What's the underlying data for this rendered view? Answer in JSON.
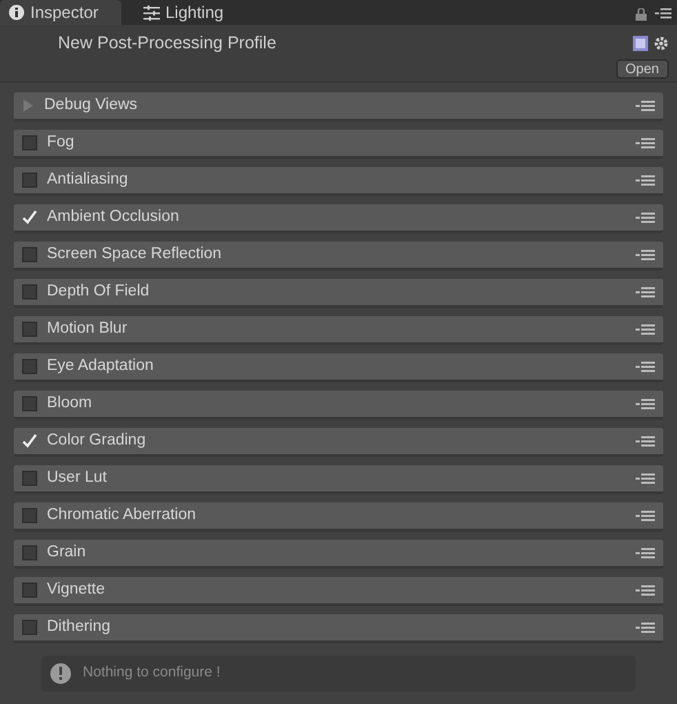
{
  "tabs": [
    {
      "label": "Inspector",
      "selected": true
    },
    {
      "label": "Lighting",
      "selected": false
    }
  ],
  "header": {
    "title": "New Post-Processing Profile",
    "open_button": "Open"
  },
  "effects": [
    {
      "kind": "foldout",
      "label": "Debug Views",
      "expanded": false
    },
    {
      "kind": "toggle",
      "label": "Fog",
      "checked": false
    },
    {
      "kind": "toggle",
      "label": "Antialiasing",
      "checked": false
    },
    {
      "kind": "toggle",
      "label": "Ambient Occlusion",
      "checked": true
    },
    {
      "kind": "toggle",
      "label": "Screen Space Reflection",
      "checked": false
    },
    {
      "kind": "toggle",
      "label": "Depth Of Field",
      "checked": false
    },
    {
      "kind": "toggle",
      "label": "Motion Blur",
      "checked": false
    },
    {
      "kind": "toggle",
      "label": "Eye Adaptation",
      "checked": false
    },
    {
      "kind": "toggle",
      "label": "Bloom",
      "checked": false
    },
    {
      "kind": "toggle",
      "label": "Color Grading",
      "checked": true
    },
    {
      "kind": "toggle",
      "label": "User Lut",
      "checked": false
    },
    {
      "kind": "toggle",
      "label": "Chromatic Aberration",
      "checked": false
    },
    {
      "kind": "toggle",
      "label": "Grain",
      "checked": false
    },
    {
      "kind": "toggle",
      "label": "Vignette",
      "checked": false
    },
    {
      "kind": "toggle",
      "label": "Dithering",
      "checked": false
    }
  ],
  "help_box": {
    "message": "Nothing to configure !"
  }
}
